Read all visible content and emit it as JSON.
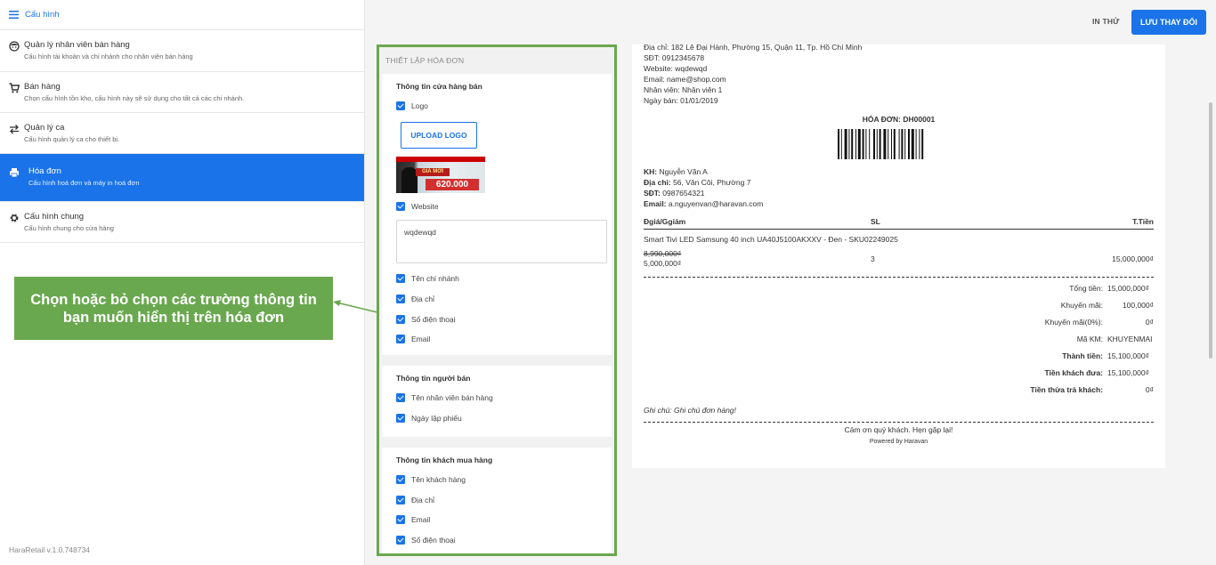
{
  "sidebar": {
    "header": "Cấu hình",
    "items": [
      {
        "title": "Quản lý nhân viên bán hàng",
        "subtitle": "Cấu hình tài khoản và chi nhánh cho nhân viên bán hàng",
        "icon": "face-icon"
      },
      {
        "title": "Bán hàng",
        "subtitle": "Chọn cấu hình tồn kho, cấu hình này sẽ sử dụng cho tất cả các chi nhánh.",
        "icon": "cart-icon"
      },
      {
        "title": "Quản lý ca",
        "subtitle": "Cấu hình quản lý ca cho thiết bị.",
        "icon": "swap-icon"
      },
      {
        "title": "Hóa đơn",
        "subtitle": "Cấu hình hoá đơn và máy in hoá đơn",
        "icon": "printer-icon",
        "active": true
      },
      {
        "title": "Cấu hình chung",
        "subtitle": "Cấu hình chung cho cửa hàng",
        "icon": "gear-icon"
      }
    ],
    "version": "HaraRetail v.1.0.748734"
  },
  "toolbar": {
    "print_label": "IN THỬ",
    "save_label": "LƯU THAY ĐỔI"
  },
  "settings": {
    "title": "THIẾT LẬP HÓA ĐƠN",
    "store": {
      "title": "Thông tin cửa hàng bán",
      "logo_label": "Logo",
      "upload_label": "UPLOAD LOGO",
      "logo_text": "GIÁ MỚI",
      "logo_price": "620.000",
      "website_label": "Website",
      "website_value": "wqdewqd",
      "fields": [
        "Tên chi nhánh",
        "Địa chỉ",
        "Số điện thoại",
        "Email"
      ]
    },
    "seller": {
      "title": "Thông tin người bán",
      "fields": [
        "Tên nhân viên bán hàng",
        "Ngày lập phiếu"
      ]
    },
    "buyer": {
      "title": "Thông tin khách mua hàng",
      "fields": [
        "Tên khách hàng",
        "Địa chỉ",
        "Email",
        "Số điện thoại"
      ]
    }
  },
  "receipt": {
    "store_lines": [
      "Địa chỉ: 182 Lê Đại Hành, Phường 15, Quận 11, Tp. Hồ Chí Minh",
      "SĐT: 0912345678",
      "Website: wqdewqd",
      "Email: name@shop.com",
      "Nhân viên: Nhân viên 1",
      "Ngày bán: 01/01/2019"
    ],
    "invoice_title": "HÓA ĐƠN: DH00001",
    "customer": {
      "name_label": "KH:",
      "name": "Nguyễn Văn A",
      "address_label": "Địa chỉ:",
      "address": "56, Vân Côi, Phường 7",
      "phone_label": "SĐT:",
      "phone": "0987654321",
      "email_label": "Email:",
      "email": "a.nguyenvan@haravan.com"
    },
    "table_headers": {
      "price": "Đgiá/Ggiảm",
      "qty": "SL",
      "total": "T.Tiền"
    },
    "item": {
      "name": "Smart Tivi LED Samsung 40 inch UA40J5100AKXXV - Đen - SKU02249025",
      "old_price": "8,990,000₫",
      "price": "5,000,000₫",
      "qty": "3",
      "total": "15,000,000₫"
    },
    "totals": [
      {
        "label": "Tổng tiền:",
        "value": "15,000,000₫",
        "bold": false
      },
      {
        "label": "Khuyến mãi:",
        "value": "100,000₫",
        "bold": false
      },
      {
        "label": "Khuyến mãi(0%):",
        "value": "0₫",
        "bold": false
      },
      {
        "label": "Mã KM:",
        "value": "KHUYENMAI",
        "bold": false
      },
      {
        "label": "Thành tiền:",
        "value": "15,100,000₫",
        "bold": true
      },
      {
        "label": "Tiền khách đưa:",
        "value": "15,100,000₫",
        "bold": true
      },
      {
        "label": "Tiền thừa trả khách:",
        "value": "0₫",
        "bold": true
      }
    ],
    "note": "Ghi chú: Ghi chú đơn hàng!",
    "thanks": "Cảm ơn quý khách. Hẹn gặp lại!",
    "powered": "Powered by Haravan"
  },
  "callout": {
    "text": "Chọn hoặc bỏ chọn các trường thông tin bạn muốn hiển thị trên hóa đơn"
  },
  "colors": {
    "accent": "#1a73e8",
    "annotation": "#6aa84f"
  }
}
